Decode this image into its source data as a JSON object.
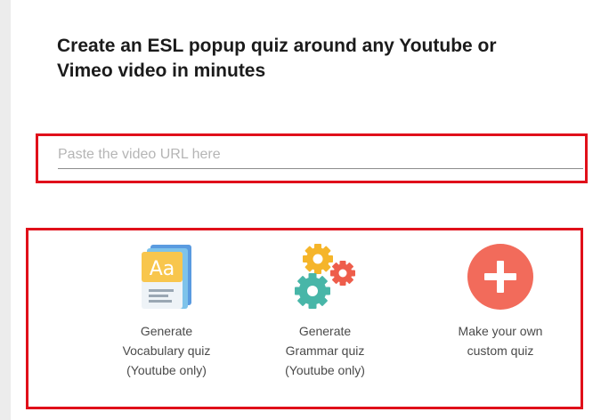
{
  "headline": {
    "line1": "Create an ESL popup quiz around any Youtube or",
    "line2": "Vimeo video in minutes"
  },
  "url_input": {
    "placeholder": "Paste the video URL here",
    "value": ""
  },
  "options": [
    {
      "icon": "vocabulary-card-icon",
      "lines": [
        "Generate",
        "Vocabulary quiz",
        "(Youtube only)"
      ]
    },
    {
      "icon": "gears-icon",
      "lines": [
        "Generate",
        "Grammar quiz",
        "(Youtube only)"
      ]
    },
    {
      "icon": "plus-circle-icon",
      "lines": [
        "Make your own",
        "custom quiz"
      ]
    }
  ],
  "vocab_icon_text": "Aa",
  "colors": {
    "highlight_border": "#e0101a",
    "plus_circle": "#f26b5b",
    "gear_yellow": "#f5b52a",
    "gear_red": "#ee5d4b",
    "gear_teal": "#48b6a8",
    "vocab_card": "#f8c64d",
    "vocab_tile": "#5a9be0"
  }
}
